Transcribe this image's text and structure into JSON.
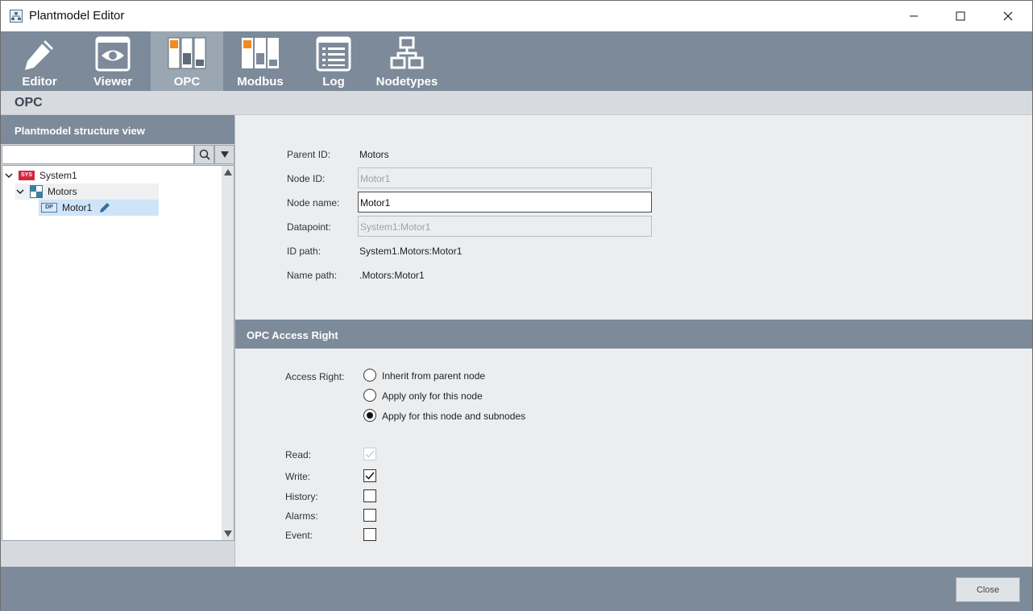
{
  "window": {
    "title": "Plantmodel Editor"
  },
  "toolbar": {
    "tabs": [
      {
        "label": "Editor",
        "icon": "pencil-icon"
      },
      {
        "label": "Viewer",
        "icon": "eye-icon"
      },
      {
        "label": "OPC",
        "icon": "opc-icon"
      },
      {
        "label": "Modbus",
        "icon": "modbus-icon"
      },
      {
        "label": "Log",
        "icon": "log-icon"
      },
      {
        "label": "Nodetypes",
        "icon": "nodetypes-icon"
      }
    ],
    "active": "OPC"
  },
  "section": {
    "title": "OPC"
  },
  "left": {
    "header": "Plantmodel structure view",
    "search": {
      "value": "",
      "placeholder": ""
    },
    "tree": [
      {
        "label": "System1",
        "badge": "SYS"
      },
      {
        "label": "Motors"
      },
      {
        "label": "Motor1",
        "badge": "DP"
      }
    ]
  },
  "form": {
    "parent_id_label": "Parent ID:",
    "parent_id_value": "Motors",
    "node_id_label": "Node ID:",
    "node_id_value": "Motor1",
    "node_name_label": "Node name:",
    "node_name_value": "Motor1",
    "datapoint_label": "Datapoint:",
    "datapoint_value": "System1:Motor1",
    "id_path_label": "ID path:",
    "id_path_value": "System1.Motors:Motor1",
    "name_path_label": "Name path:",
    "name_path_value": ".Motors:Motor1"
  },
  "access": {
    "header": "OPC Access Right",
    "label": "Access Right:",
    "options": [
      {
        "label": "Inherit from parent node",
        "selected": false
      },
      {
        "label": "Apply only for this node",
        "selected": false
      },
      {
        "label": "Apply for this node and subnodes",
        "selected": true
      }
    ],
    "checks": [
      {
        "label": "Read:",
        "checked": true,
        "enabled": false
      },
      {
        "label": "Write:",
        "checked": true,
        "enabled": true
      },
      {
        "label": "History:",
        "checked": false,
        "enabled": true
      },
      {
        "label": "Alarms:",
        "checked": false,
        "enabled": true
      },
      {
        "label": "Event:",
        "checked": false,
        "enabled": true
      }
    ]
  },
  "footer": {
    "close_label": "Close"
  },
  "colors": {
    "bar": "#7c8a99",
    "active_tab": "#9aa6b2",
    "panel": "#ebedef",
    "sys_badge": "#d4263f",
    "accent_orange": "#f28a1f"
  }
}
